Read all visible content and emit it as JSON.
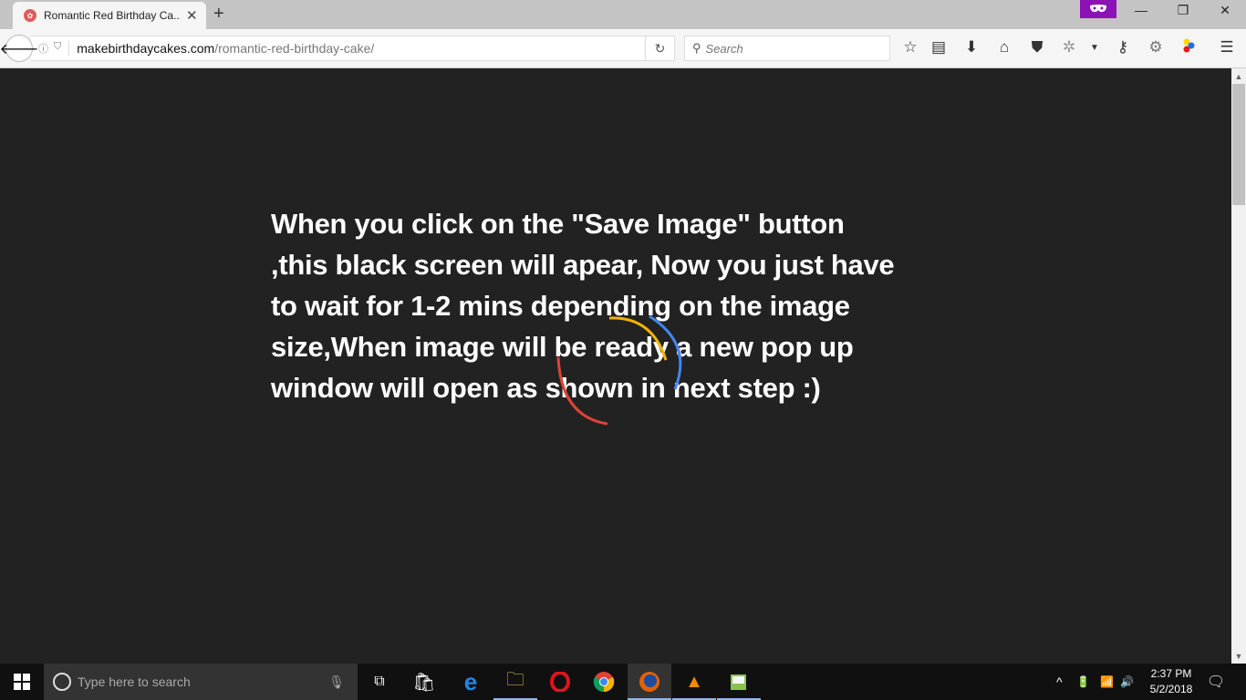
{
  "browser": {
    "tab": {
      "title": "Romantic Red Birthday Ca...",
      "favicon": "cake-favicon-icon"
    },
    "new_tab_label": "+",
    "window_controls": {
      "minimize": "—",
      "restore": "❐",
      "close": "✕"
    },
    "url": {
      "domain": "makebirthdaycakes.com",
      "path": "/romantic-red-birthday-cake/"
    },
    "search": {
      "placeholder": "Search"
    },
    "toolbar_icons": [
      "bookmark-star-icon",
      "reading-list-icon",
      "download-icon",
      "home-icon",
      "pocket-icon",
      "extension-bug-icon",
      "dropdown-icon",
      "eyedropper-icon",
      "settings-gear-icon",
      "color-dots-icon",
      "menu-icon"
    ]
  },
  "page": {
    "message": "When you click on the \"Save Image\" button ,this black screen will apear, Now you just have to wait for 1-2 mins depending on the image size,When image will be ready a new pop up window will open as shown in next step :)",
    "spinner_colors": {
      "yellow": "#f4b400",
      "blue": "#4285f4",
      "red": "#db4437"
    }
  },
  "taskbar": {
    "search_placeholder": "Type here to search",
    "apps": [
      "task-view",
      "store",
      "edge",
      "file-explorer",
      "opera",
      "chrome",
      "firefox",
      "vlc",
      "notepad-plus"
    ],
    "clock": {
      "time": "2:37 PM",
      "date": "5/2/2018"
    }
  }
}
